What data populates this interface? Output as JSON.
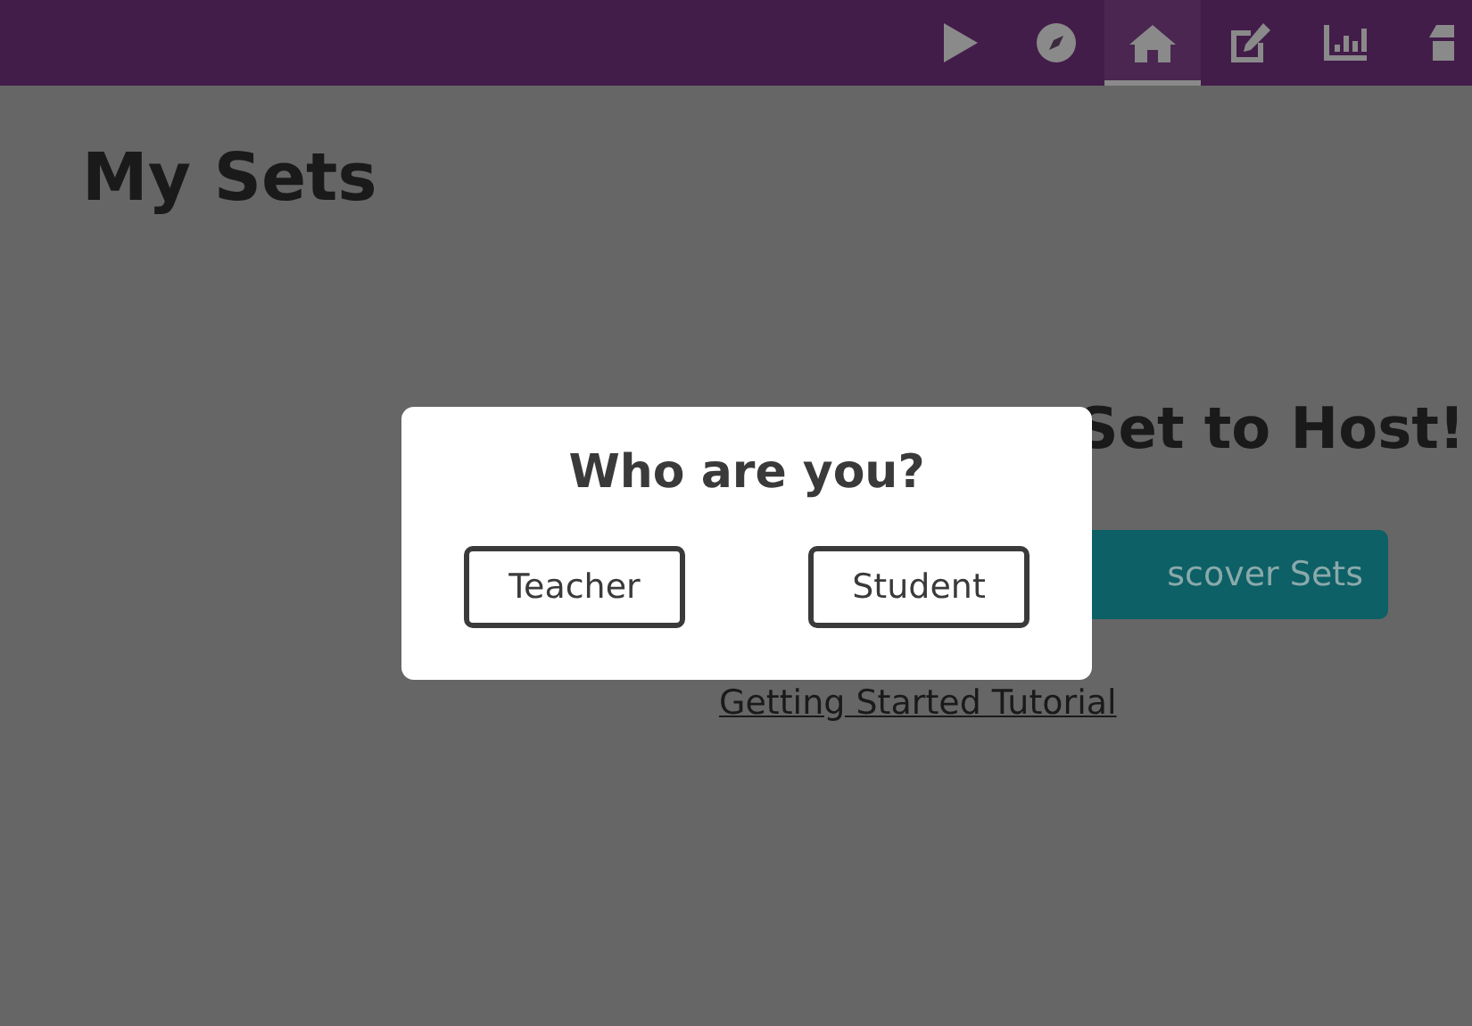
{
  "nav": [
    {
      "kind": "play",
      "selected": false
    },
    {
      "kind": "compass",
      "selected": false
    },
    {
      "kind": "home",
      "selected": true
    },
    {
      "kind": "edit",
      "selected": false
    },
    {
      "kind": "chart",
      "selected": false
    },
    {
      "kind": "store",
      "selected": false
    }
  ],
  "page": {
    "title": "My Sets",
    "empty_heading": "Set to Host!",
    "discover_button": "scover Sets",
    "tutorial_link": "Getting Started Tutorial"
  },
  "dialog": {
    "title": "Who are you?",
    "buttons": [
      "Teacher",
      "Student"
    ]
  }
}
